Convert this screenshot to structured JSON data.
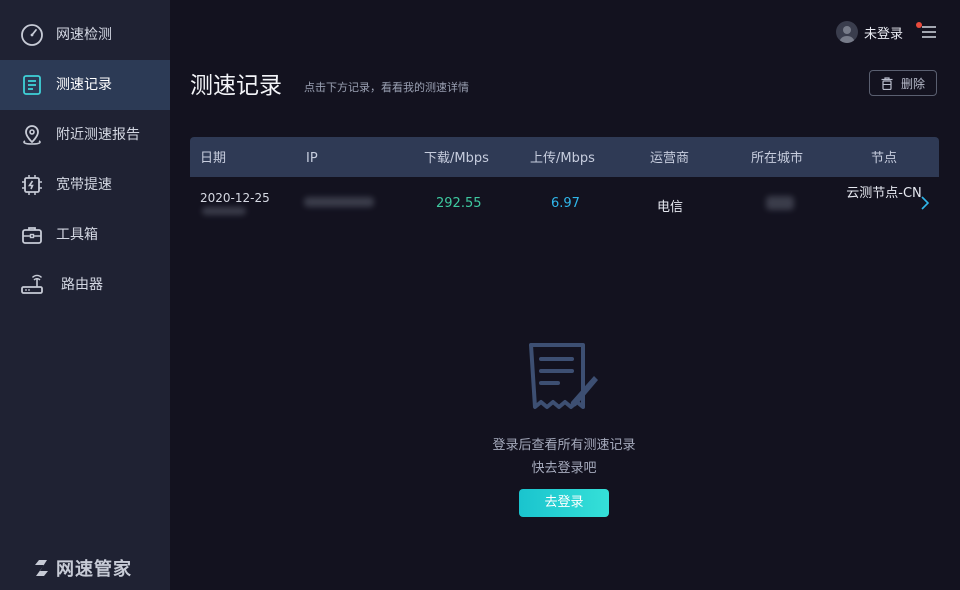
{
  "sidebar": {
    "items": [
      {
        "label": "网速检测",
        "icon": "speedometer-icon"
      },
      {
        "label": "测速记录",
        "icon": "record-list-icon",
        "active": true
      },
      {
        "label": "附近测速报告",
        "icon": "location-pin-icon"
      },
      {
        "label": "宽带提速",
        "icon": "chip-boost-icon"
      },
      {
        "label": "工具箱",
        "icon": "toolbox-icon"
      },
      {
        "label": "路由器",
        "icon": "router-icon"
      }
    ],
    "brand": "网速管家"
  },
  "header": {
    "username": "未登录",
    "title": "测速记录",
    "subtitle": "点击下方记录，看看我的测速详情",
    "delete_label": "删除"
  },
  "table": {
    "columns": [
      "日期",
      "IP",
      "下载/Mbps",
      "上传/Mbps",
      "运营商",
      "所在城市",
      "节点"
    ],
    "rows": [
      {
        "date": "2020-12-25",
        "download": "292.55",
        "upload": "6.97",
        "isp": "电信",
        "node": "云测节点-CN"
      }
    ]
  },
  "empty_state": {
    "line1": "登录后查看所有测速记录",
    "line2": "快去登录吧",
    "button": "去登录"
  },
  "colors": {
    "background": "#13121f",
    "sidebar": "#1f2233",
    "sidebar_active": "#2c3a55",
    "table_header": "#2f3a55",
    "download": "#3ec9a0",
    "upload": "#30b6ea",
    "accent": "#1ac4ce",
    "notify_dot": "#e84a3c"
  }
}
